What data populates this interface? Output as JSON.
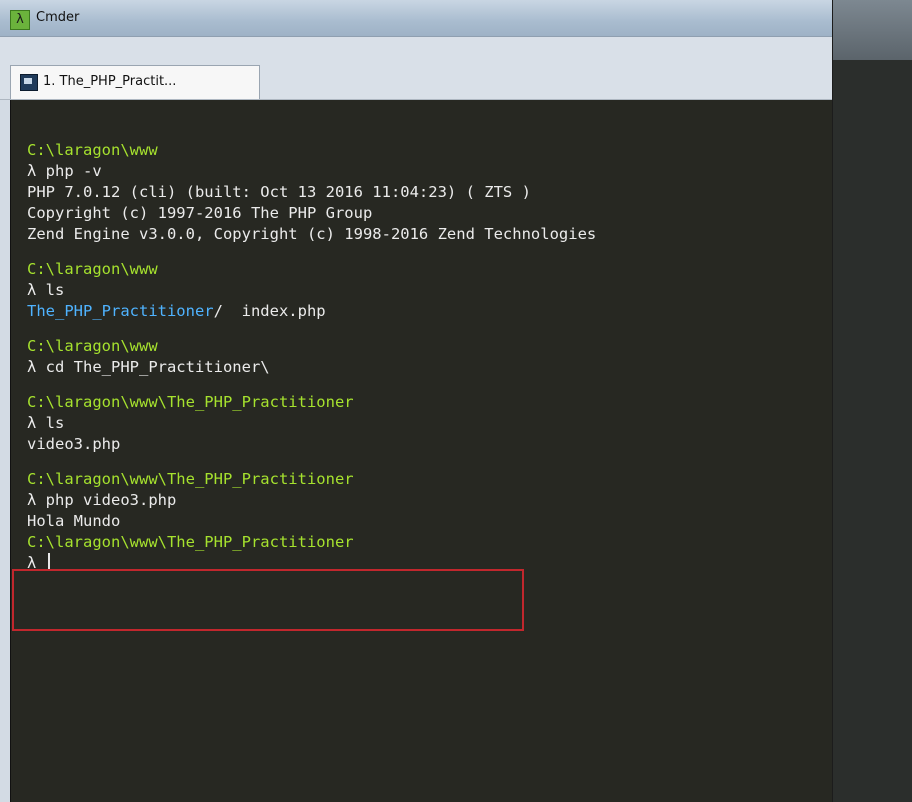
{
  "window": {
    "app_name": "Cmder",
    "app_icon": "lambda-icon"
  },
  "tabs": [
    {
      "label": "1. The_PHP_Practit...",
      "icon": "console-icon"
    }
  ],
  "terminal": {
    "blocks": [
      {
        "path": "C:\\laragon\\www",
        "command": "λ php -v",
        "output": [
          "PHP 7.0.12 (cli) (built: Oct 13 2016 11:04:23) ( ZTS )",
          "Copyright (c) 1997-2016 The PHP Group",
          "Zend Engine v3.0.0, Copyright (c) 1998-2016 Zend Technologies"
        ]
      },
      {
        "path": "C:\\laragon\\www",
        "command": "λ ls",
        "output_dir": "The_PHP_Practitioner",
        "output_dir_suffix": "/  index.php"
      },
      {
        "path": "C:\\laragon\\www",
        "command": "λ cd The_PHP_Practitioner\\"
      },
      {
        "path": "C:\\laragon\\www\\The_PHP_Practitioner",
        "command": "λ ls",
        "output": [
          "video3.php"
        ]
      },
      {
        "path": "C:\\laragon\\www\\The_PHP_Practitioner",
        "command": "λ php video3.php",
        "output": [
          "Hola Mundo"
        ]
      }
    ],
    "final_path": "C:\\laragon\\www\\The_PHP_Practitioner",
    "prompt": "λ "
  },
  "colors": {
    "terminal_bg": "#272822",
    "path_green": "#a6e22e",
    "dir_blue": "#4fb3ff",
    "highlight_red": "#c1272d"
  }
}
